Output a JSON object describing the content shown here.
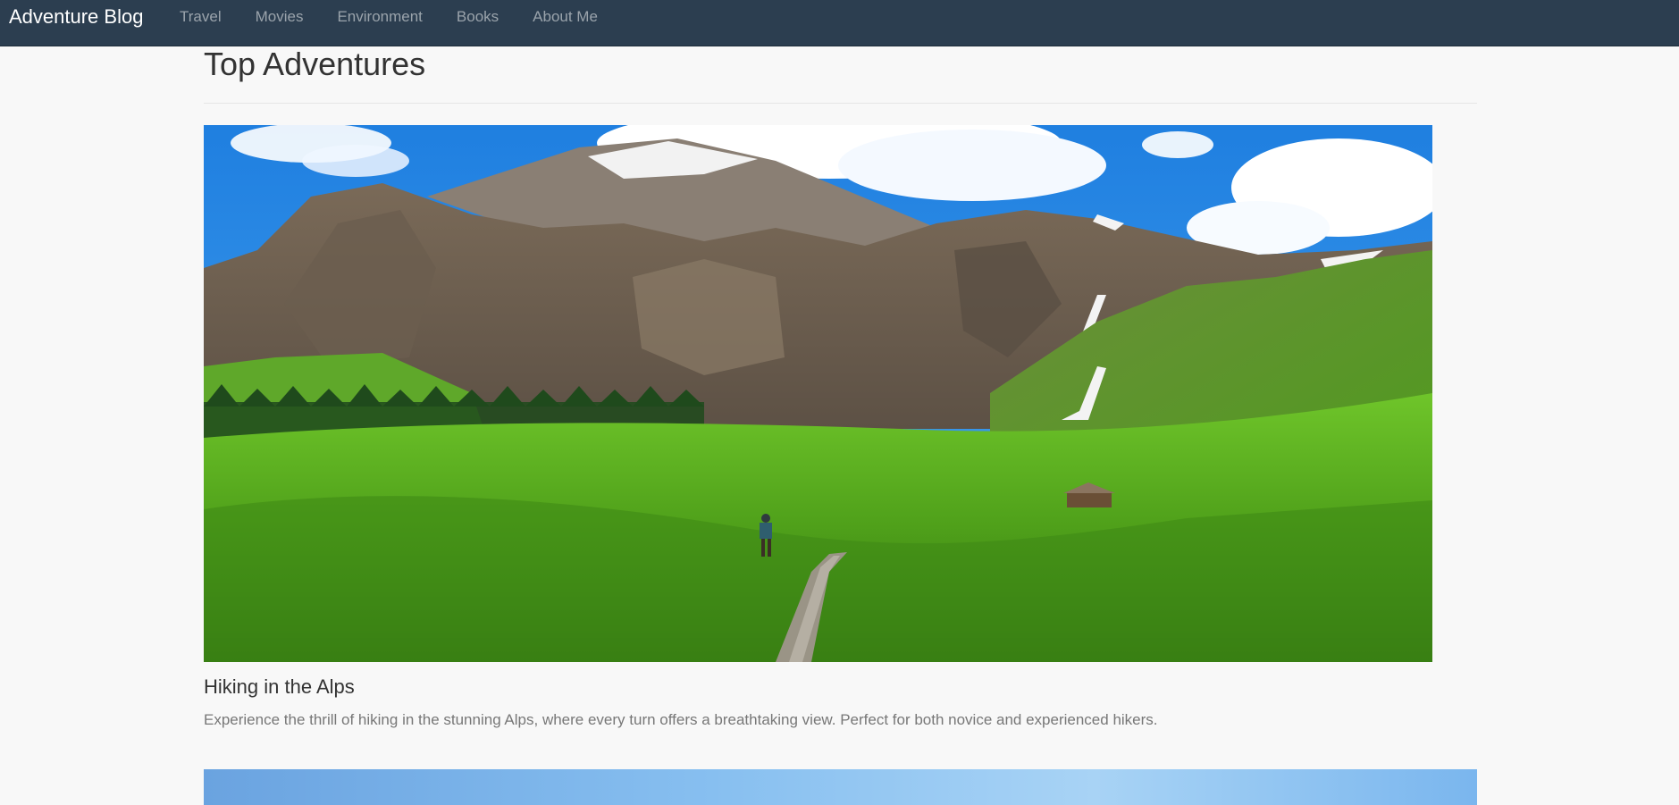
{
  "navbar": {
    "brand": "Adventure Blog",
    "links": [
      {
        "label": "Travel"
      },
      {
        "label": "Movies"
      },
      {
        "label": "Environment"
      },
      {
        "label": "Books"
      },
      {
        "label": "About Me"
      }
    ],
    "background": "#2c3e50"
  },
  "main": {
    "title": "Top Adventures",
    "posts": [
      {
        "title": "Hiking in the Alps",
        "text": "Experience the thrill of hiking in the stunning Alps, where every turn offers a breathtaking view. Perfect for both novice and experienced hikers."
      }
    ]
  }
}
